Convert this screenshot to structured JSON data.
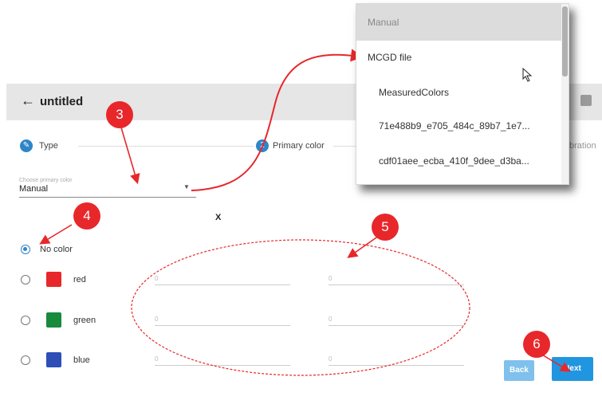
{
  "header": {
    "back_icon": "arrow-left-icon",
    "title": "untitled",
    "save_icon": "save-icon"
  },
  "steps": [
    {
      "number": "",
      "label": "Type"
    },
    {
      "number": "2",
      "label": "Primary color"
    },
    {
      "number": "",
      "label": "bration"
    }
  ],
  "select": {
    "label": "Choose primary color",
    "value": "Manual"
  },
  "column_header": "X",
  "rows": [
    {
      "label": "No color",
      "selected": true,
      "swatch": null,
      "x": "",
      "y": ""
    },
    {
      "label": "red",
      "selected": false,
      "swatch": "#e8272a",
      "x": "0",
      "y": "0"
    },
    {
      "label": "green",
      "selected": false,
      "swatch": "#188a3c",
      "x": "0",
      "y": "0"
    },
    {
      "label": "blue",
      "selected": false,
      "swatch": "#2e4fb6",
      "x": "0",
      "y": "0"
    }
  ],
  "buttons": {
    "back": "Back",
    "next": "Next"
  },
  "dropdown": {
    "options": [
      "Manual",
      "MCGD file",
      "MeasuredColors",
      "71e488b9_e705_484c_89b7_1e7...",
      "cdf01aee_ecba_410f_9dee_d3ba..."
    ],
    "highlighted": "Manual"
  },
  "callouts": [
    "3",
    "4",
    "5",
    "6"
  ],
  "colors": {
    "accent": "#2e86c8",
    "annotation": "#e8272a",
    "next_button": "#2196e0",
    "back_button": "#7fc0ec"
  }
}
